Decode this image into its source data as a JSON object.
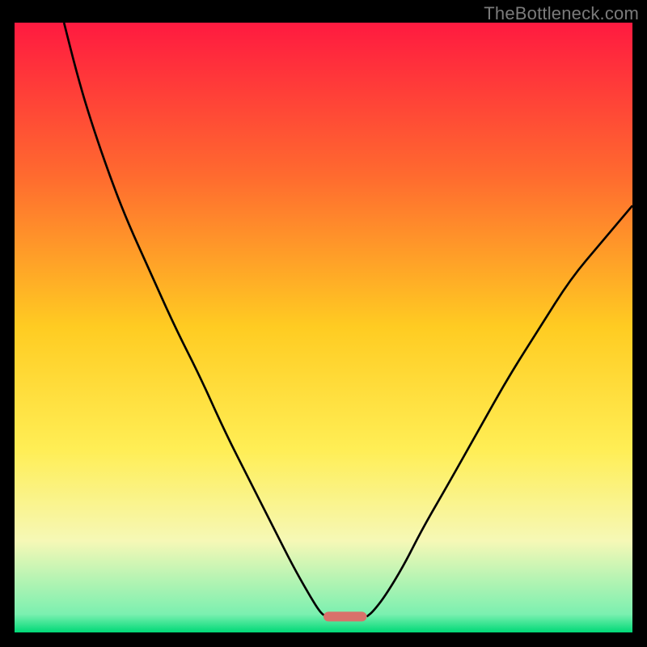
{
  "attribution": "TheBottleneck.com",
  "chart_data": {
    "type": "line",
    "title": "",
    "xlabel": "",
    "ylabel": "",
    "xlim": [
      0,
      100
    ],
    "ylim": [
      0,
      100
    ],
    "background_gradient": {
      "stops": [
        {
          "pos": 0,
          "color": "#ff1a40"
        },
        {
          "pos": 25,
          "color": "#ff6a2f"
        },
        {
          "pos": 50,
          "color": "#ffcc22"
        },
        {
          "pos": 70,
          "color": "#ffee55"
        },
        {
          "pos": 85,
          "color": "#f6f8b6"
        },
        {
          "pos": 97,
          "color": "#7bf0b0"
        },
        {
          "pos": 100,
          "color": "#00d977"
        }
      ]
    },
    "series": [
      {
        "name": "left-curve",
        "color": "#000000",
        "stroke_width": 2.2,
        "x": [
          8,
          10,
          12,
          15,
          18,
          22,
          26,
          30,
          34,
          38,
          42,
          45,
          47.5,
          49.5,
          50.5
        ],
        "y": [
          100,
          92,
          85,
          76,
          68,
          59,
          50,
          42,
          33,
          25,
          17,
          11,
          6.5,
          3.2,
          2.6
        ]
      },
      {
        "name": "right-curve",
        "color": "#000000",
        "stroke_width": 2.2,
        "x": [
          57,
          58,
          60,
          63,
          66,
          70,
          75,
          80,
          85,
          90,
          95,
          100
        ],
        "y": [
          2.6,
          3.4,
          6,
          11,
          17,
          24,
          33,
          42,
          50,
          58,
          64,
          70
        ]
      }
    ],
    "marker": {
      "name": "minimum-region",
      "shape": "rounded-rect",
      "x_center": 53.5,
      "y_center": 2.6,
      "width": 7,
      "height": 1.6,
      "color": "#d9716b"
    }
  }
}
